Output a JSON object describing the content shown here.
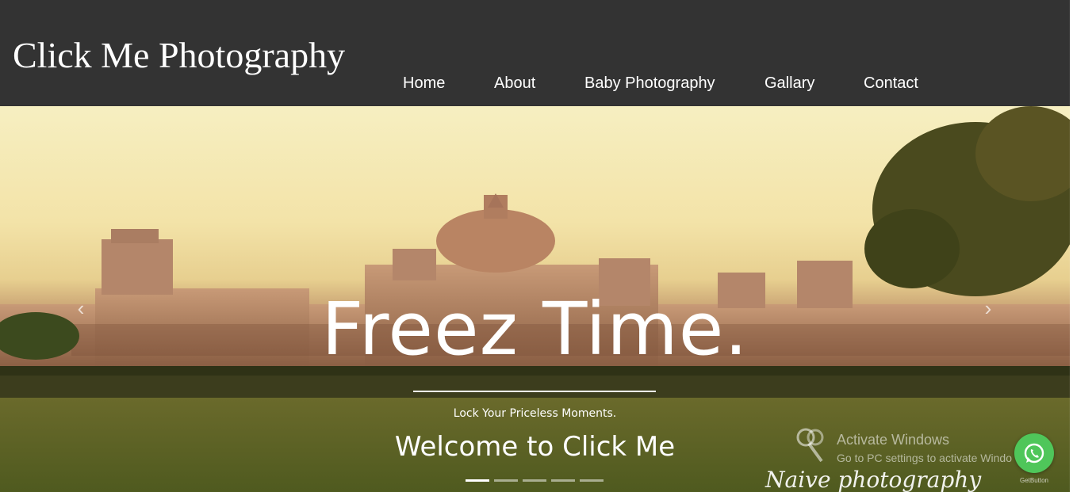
{
  "header": {
    "brand": "Click Me Photography",
    "nav": [
      {
        "label": "Home"
      },
      {
        "label": "About"
      },
      {
        "label": "Baby Photography"
      },
      {
        "label": "Gallary"
      },
      {
        "label": "Contact"
      }
    ]
  },
  "hero": {
    "title": "Freez Time.",
    "subtitle": "Lock Your Priceless Moments.",
    "welcome": "Welcome to Click Me",
    "prev_icon": "chevron-left-icon",
    "next_icon": "chevron-right-icon",
    "slides_count": 5,
    "active_slide": 1,
    "watermark": "Naive photography"
  },
  "os_overlay": {
    "activate_title": "Activate Windows",
    "activate_text": "Go to PC settings to activate Windo"
  },
  "whatsapp": {
    "icon": "whatsapp-icon",
    "label": "GetButton",
    "color": "#4fc65a"
  },
  "colors": {
    "header_bg": "#333333",
    "text": "#ffffff"
  }
}
